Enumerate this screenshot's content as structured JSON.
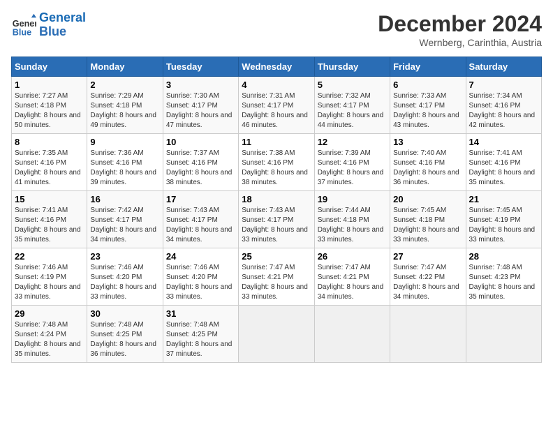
{
  "header": {
    "logo_line1": "General",
    "logo_line2": "Blue",
    "month": "December 2024",
    "location": "Wernberg, Carinthia, Austria"
  },
  "days_of_week": [
    "Sunday",
    "Monday",
    "Tuesday",
    "Wednesday",
    "Thursday",
    "Friday",
    "Saturday"
  ],
  "weeks": [
    [
      {
        "day": "1",
        "sunrise": "7:27 AM",
        "sunset": "4:18 PM",
        "daylight": "8 hours and 50 minutes."
      },
      {
        "day": "2",
        "sunrise": "7:29 AM",
        "sunset": "4:18 PM",
        "daylight": "8 hours and 49 minutes."
      },
      {
        "day": "3",
        "sunrise": "7:30 AM",
        "sunset": "4:17 PM",
        "daylight": "8 hours and 47 minutes."
      },
      {
        "day": "4",
        "sunrise": "7:31 AM",
        "sunset": "4:17 PM",
        "daylight": "8 hours and 46 minutes."
      },
      {
        "day": "5",
        "sunrise": "7:32 AM",
        "sunset": "4:17 PM",
        "daylight": "8 hours and 44 minutes."
      },
      {
        "day": "6",
        "sunrise": "7:33 AM",
        "sunset": "4:17 PM",
        "daylight": "8 hours and 43 minutes."
      },
      {
        "day": "7",
        "sunrise": "7:34 AM",
        "sunset": "4:16 PM",
        "daylight": "8 hours and 42 minutes."
      }
    ],
    [
      {
        "day": "8",
        "sunrise": "7:35 AM",
        "sunset": "4:16 PM",
        "daylight": "8 hours and 41 minutes."
      },
      {
        "day": "9",
        "sunrise": "7:36 AM",
        "sunset": "4:16 PM",
        "daylight": "8 hours and 39 minutes."
      },
      {
        "day": "10",
        "sunrise": "7:37 AM",
        "sunset": "4:16 PM",
        "daylight": "8 hours and 38 minutes."
      },
      {
        "day": "11",
        "sunrise": "7:38 AM",
        "sunset": "4:16 PM",
        "daylight": "8 hours and 38 minutes."
      },
      {
        "day": "12",
        "sunrise": "7:39 AM",
        "sunset": "4:16 PM",
        "daylight": "8 hours and 37 minutes."
      },
      {
        "day": "13",
        "sunrise": "7:40 AM",
        "sunset": "4:16 PM",
        "daylight": "8 hours and 36 minutes."
      },
      {
        "day": "14",
        "sunrise": "7:41 AM",
        "sunset": "4:16 PM",
        "daylight": "8 hours and 35 minutes."
      }
    ],
    [
      {
        "day": "15",
        "sunrise": "7:41 AM",
        "sunset": "4:16 PM",
        "daylight": "8 hours and 35 minutes."
      },
      {
        "day": "16",
        "sunrise": "7:42 AM",
        "sunset": "4:17 PM",
        "daylight": "8 hours and 34 minutes."
      },
      {
        "day": "17",
        "sunrise": "7:43 AM",
        "sunset": "4:17 PM",
        "daylight": "8 hours and 34 minutes."
      },
      {
        "day": "18",
        "sunrise": "7:43 AM",
        "sunset": "4:17 PM",
        "daylight": "8 hours and 33 minutes."
      },
      {
        "day": "19",
        "sunrise": "7:44 AM",
        "sunset": "4:18 PM",
        "daylight": "8 hours and 33 minutes."
      },
      {
        "day": "20",
        "sunrise": "7:45 AM",
        "sunset": "4:18 PM",
        "daylight": "8 hours and 33 minutes."
      },
      {
        "day": "21",
        "sunrise": "7:45 AM",
        "sunset": "4:19 PM",
        "daylight": "8 hours and 33 minutes."
      }
    ],
    [
      {
        "day": "22",
        "sunrise": "7:46 AM",
        "sunset": "4:19 PM",
        "daylight": "8 hours and 33 minutes."
      },
      {
        "day": "23",
        "sunrise": "7:46 AM",
        "sunset": "4:20 PM",
        "daylight": "8 hours and 33 minutes."
      },
      {
        "day": "24",
        "sunrise": "7:46 AM",
        "sunset": "4:20 PM",
        "daylight": "8 hours and 33 minutes."
      },
      {
        "day": "25",
        "sunrise": "7:47 AM",
        "sunset": "4:21 PM",
        "daylight": "8 hours and 33 minutes."
      },
      {
        "day": "26",
        "sunrise": "7:47 AM",
        "sunset": "4:21 PM",
        "daylight": "8 hours and 34 minutes."
      },
      {
        "day": "27",
        "sunrise": "7:47 AM",
        "sunset": "4:22 PM",
        "daylight": "8 hours and 34 minutes."
      },
      {
        "day": "28",
        "sunrise": "7:48 AM",
        "sunset": "4:23 PM",
        "daylight": "8 hours and 35 minutes."
      }
    ],
    [
      {
        "day": "29",
        "sunrise": "7:48 AM",
        "sunset": "4:24 PM",
        "daylight": "8 hours and 35 minutes."
      },
      {
        "day": "30",
        "sunrise": "7:48 AM",
        "sunset": "4:25 PM",
        "daylight": "8 hours and 36 minutes."
      },
      {
        "day": "31",
        "sunrise": "7:48 AM",
        "sunset": "4:25 PM",
        "daylight": "8 hours and 37 minutes."
      },
      null,
      null,
      null,
      null
    ]
  ]
}
